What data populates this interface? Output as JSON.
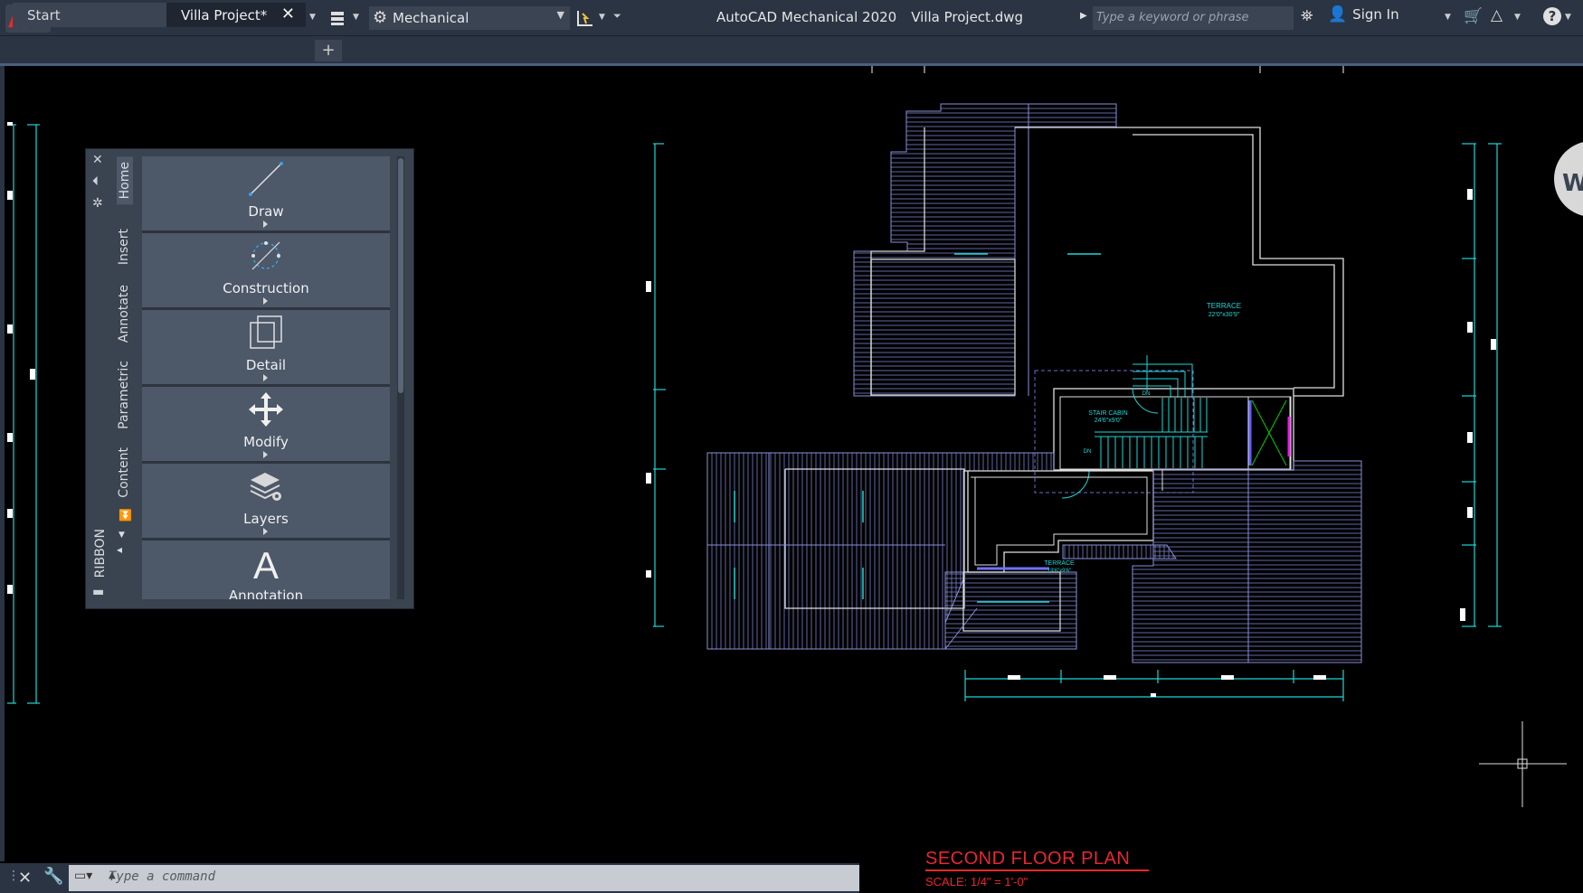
{
  "app": {
    "logo_letter": "A",
    "logo_sub": "M",
    "workspace": "Mechanical",
    "title_app": "AutoCAD Mechanical 2020",
    "title_file": "Villa Project.dwg",
    "search_placeholder": "Type a keyword or phrase",
    "sign_in": "Sign In"
  },
  "tabs": [
    {
      "label": "Start"
    },
    {
      "label": "Villa Project*"
    }
  ],
  "ribbon": {
    "label": "RIBBON",
    "tabs": [
      "Home",
      "Insert",
      "Annotate",
      "Parametric",
      "Content"
    ],
    "panels": [
      {
        "label": "Draw",
        "icon": "line-icon"
      },
      {
        "label": "Construction",
        "icon": "construction-icon"
      },
      {
        "label": "Detail",
        "icon": "detail-icon"
      },
      {
        "label": "Modify",
        "icon": "move-icon"
      },
      {
        "label": "Layers",
        "icon": "layers-icon"
      },
      {
        "label": "Annotation",
        "icon": "text-a-icon"
      }
    ]
  },
  "command": {
    "placeholder": "Type  a  command"
  },
  "drawing": {
    "plan_title": "SECOND FLOOR PLAN",
    "scale": "SCALE: 1/4\" = 1'-0\"",
    "labels": [
      {
        "text": "TERRACE"
      },
      {
        "text": "22'0\"x30'9\""
      },
      {
        "text": "STAIR CABIN"
      },
      {
        "text": "24'6\"x9'0\""
      },
      {
        "text": "TERRACE"
      },
      {
        "text": "19'6\"x9'6\""
      },
      {
        "text": "DN"
      },
      {
        "text": "DN"
      }
    ]
  },
  "colors": {
    "accent": "#e8282e",
    "cyan": "#1fd6d6",
    "drawing_lines": "#8a8fd8",
    "bg": "#000000"
  }
}
